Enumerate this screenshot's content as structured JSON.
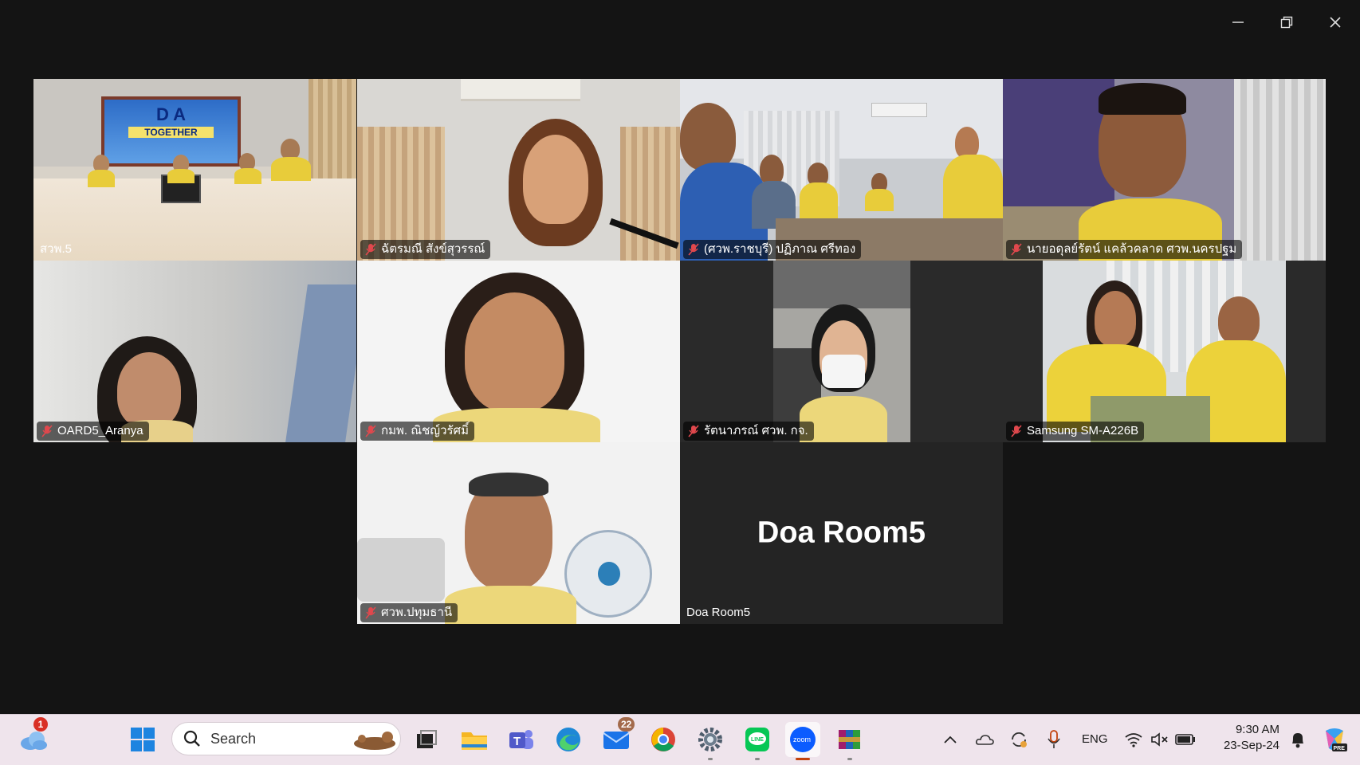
{
  "window": {
    "controls": {
      "minimize": "minimize-icon",
      "restore": "restore-icon",
      "close": "close-icon"
    }
  },
  "participants": [
    {
      "name": "สวพ.5",
      "muted": false,
      "active_speaker": true,
      "bg": "#d8d2c8"
    },
    {
      "name": "ฉัตรมณี สังข์สุวรรณ์",
      "muted": true,
      "active_speaker": false,
      "bg": "#d9d7d3"
    },
    {
      "name": "(ศวพ.ราชบุรี) ปฏิภาณ ศรีทอง",
      "muted": true,
      "active_speaker": false,
      "bg": "#c9ccd0"
    },
    {
      "name": "นายอดุลย์รัตน์ แคล้วคลาด ศวพ.นครปฐม",
      "muted": true,
      "active_speaker": false,
      "bg": "#8e8aa0"
    },
    {
      "name": "OARD5_Aranya",
      "muted": true,
      "active_speaker": false,
      "bg": "#d4d4d2"
    },
    {
      "name": "กมพ. ณิชญ์วรัศมิ์",
      "muted": true,
      "active_speaker": false,
      "bg": "#f4f4f4"
    },
    {
      "name": "รัตนาภรณ์ ศวพ. กจ.",
      "muted": true,
      "active_speaker": false,
      "bg": "#2a2a2a"
    },
    {
      "name": "Samsung SM-A226B",
      "muted": true,
      "active_speaker": false,
      "bg": "#2a2a2a"
    },
    {
      "name": "ศวพ.ปทุมธานี",
      "muted": true,
      "active_speaker": false,
      "bg": "#f2f2f2"
    },
    {
      "name": "Doa Room5",
      "display_name": "Doa Room5",
      "muted": false,
      "video_off": true,
      "bg": "#242424"
    }
  ],
  "room_poster": {
    "line1": "D  A",
    "line2": "TOGETHER"
  },
  "taskbar": {
    "weather_badge": "1",
    "search_placeholder": "Search",
    "mail_badge": "22",
    "language": "ENG",
    "time": "9:30 AM",
    "date": "23-Sep-24",
    "zoom_icon_text": "zoom",
    "line_icon_text": "LINE",
    "copilot_tag": "PRE",
    "accent": "#c2410c"
  }
}
